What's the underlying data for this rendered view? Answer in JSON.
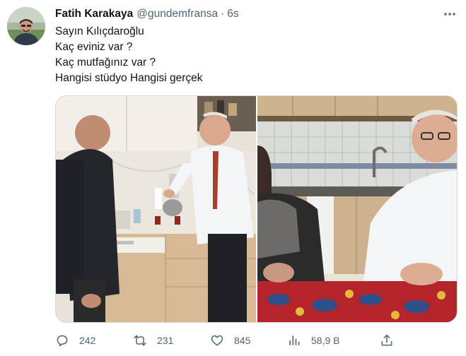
{
  "tweet": {
    "author_name": "Fatih Karakaya",
    "author_handle": "@gundemfransa",
    "separator": "·",
    "time": "6s",
    "lines": [
      "Sayın Kılıçdaroğlu",
      "Kaç eviniz var ?",
      "Kaç mutfağınız var ?",
      "Hangisi stüdyo Hangisi gerçek"
    ]
  },
  "media": {
    "photos": [
      {
        "name": "kitchen-photo-left"
      },
      {
        "name": "kitchen-photo-right"
      }
    ]
  },
  "actions": {
    "reply_count": "242",
    "retweet_count": "231",
    "like_count": "845",
    "views_count": "58,9 B"
  },
  "icons": {
    "more": "more-icon",
    "reply": "reply-icon",
    "retweet": "retweet-icon",
    "like": "heart-icon",
    "views": "views-icon",
    "share": "share-icon"
  },
  "colors": {
    "text_primary": "#0f1419",
    "text_secondary": "#536471",
    "border": "#cfd9de"
  }
}
